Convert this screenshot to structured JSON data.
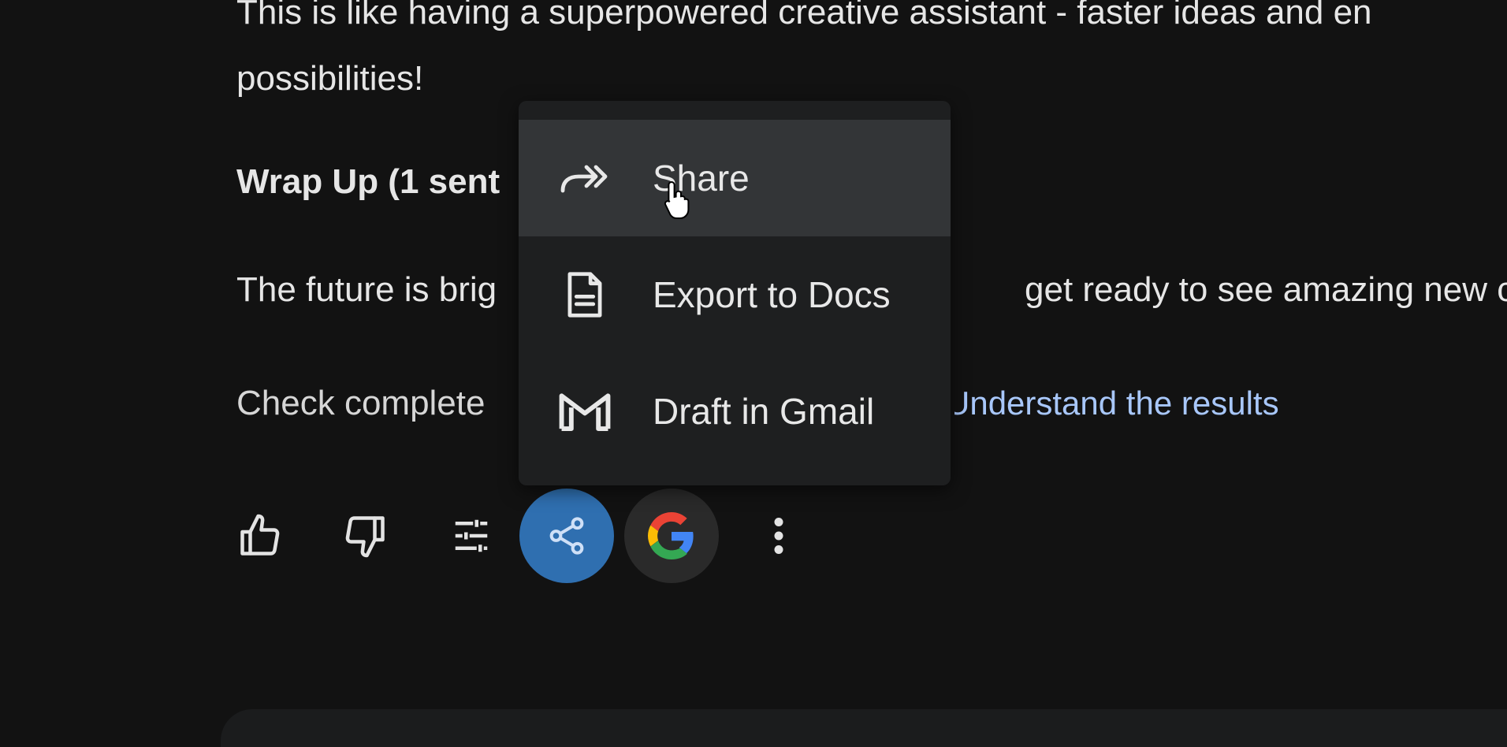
{
  "response": {
    "line1": "This is like having a superpowered creative assistant - faster ideas and en",
    "line1b": "possibilities!",
    "heading": "Wrap Up (1 sent",
    "para": "The future is brig",
    "para_tail": "get ready to see amazing new cr",
    "check": "Check complete",
    "link": "Understand the results"
  },
  "actions": {
    "like_icon": "thumbs-up-icon",
    "dislike_icon": "thumbs-down-icon",
    "modify_icon": "tune-icon",
    "share_icon": "share-icon",
    "google_icon": "google-g-icon",
    "more_icon": "more-vert-icon"
  },
  "menu": {
    "items": [
      {
        "label": "Share",
        "icon": "forward-arrow-icon"
      },
      {
        "label": "Export to Docs",
        "icon": "docs-icon"
      },
      {
        "label": "Draft in Gmail",
        "icon": "gmail-icon"
      }
    ]
  },
  "colors": {
    "background": "#121212",
    "menu_bg": "#1e1f20",
    "menu_hover": "#333537",
    "link": "#a8c7fa",
    "share_active": "#2f6fb0"
  }
}
